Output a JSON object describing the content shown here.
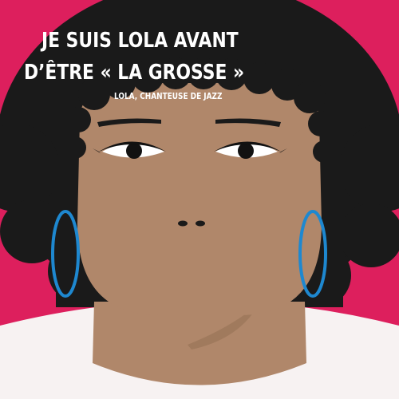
{
  "headline": {
    "line1": "JE SUIS LOLA AVANT",
    "line2": "D’ÊTRE « LA GROSSE »"
  },
  "caption": "LOLA, CHANTEUSE DE JAZZ",
  "colors": {
    "background": "#dd1f5d",
    "hair": "#1a1a1a",
    "skin": "#b0876a",
    "skin_shadow": "#a07a5d",
    "earring": "#1e88d0",
    "shirt": "#f7f2f2",
    "text": "#ffffff"
  },
  "icons": {
    "illustration": "woman-portrait-illustration"
  }
}
